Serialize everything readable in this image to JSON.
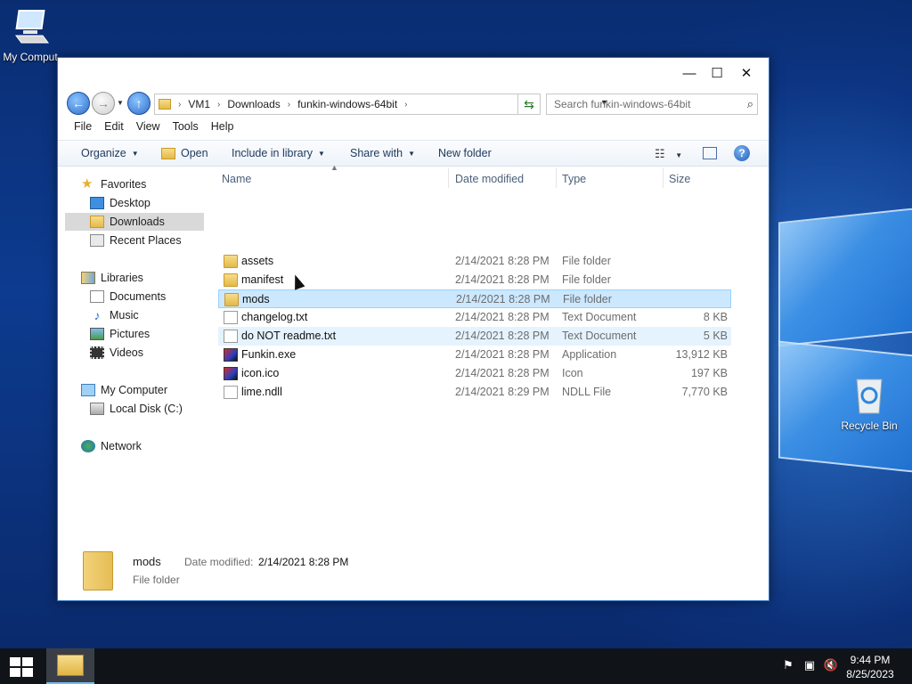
{
  "desktop": {
    "icons": [
      {
        "label": "My Comput"
      },
      {
        "label": "Recycle Bin"
      }
    ]
  },
  "window": {
    "caption": {
      "minimize": "—",
      "maximize": "☐",
      "close": "✕"
    },
    "address": {
      "crumbs": [
        "VM1",
        "Downloads",
        "funkin-windows-64bit"
      ],
      "search_placeholder": "Search funkin-windows-64bit"
    },
    "menu": [
      "File",
      "Edit",
      "View",
      "Tools",
      "Help"
    ],
    "toolbar": {
      "organize": "Organize",
      "open": "Open",
      "include": "Include in library",
      "share": "Share with",
      "new_folder": "New folder"
    },
    "nav": {
      "favorites": "Favorites",
      "desktop": "Desktop",
      "downloads": "Downloads",
      "recent": "Recent Places",
      "libraries": "Libraries",
      "documents": "Documents",
      "music": "Music",
      "pictures": "Pictures",
      "videos": "Videos",
      "computer": "My Computer",
      "localdisk": "Local Disk (C:)",
      "network": "Network"
    },
    "columns": {
      "name": "Name",
      "date": "Date modified",
      "type": "Type",
      "size": "Size"
    },
    "files": [
      {
        "name": "assets",
        "date": "2/14/2021 8:28 PM",
        "type": "File folder",
        "size": "",
        "icon": "folder-icon"
      },
      {
        "name": "manifest",
        "date": "2/14/2021 8:28 PM",
        "type": "File folder",
        "size": "",
        "icon": "folder-icon"
      },
      {
        "name": "mods",
        "date": "2/14/2021 8:28 PM",
        "type": "File folder",
        "size": "",
        "icon": "folder-icon"
      },
      {
        "name": "changelog.txt",
        "date": "2/14/2021 8:28 PM",
        "type": "Text Document",
        "size": "8 KB",
        "icon": "text-file-icon"
      },
      {
        "name": "do NOT readme.txt",
        "date": "2/14/2021 8:28 PM",
        "type": "Text Document",
        "size": "5 KB",
        "icon": "text-file-icon"
      },
      {
        "name": "Funkin.exe",
        "date": "2/14/2021 8:28 PM",
        "type": "Application",
        "size": "13,912 KB",
        "icon": "app-icon"
      },
      {
        "name": "icon.ico",
        "date": "2/14/2021 8:28 PM",
        "type": "Icon",
        "size": "197 KB",
        "icon": "app-icon"
      },
      {
        "name": "lime.ndll",
        "date": "2/14/2021 8:29 PM",
        "type": "NDLL File",
        "size": "7,770 KB",
        "icon": "generic-file-icon"
      }
    ],
    "details": {
      "name": "mods",
      "label": "Date modified:",
      "value": "2/14/2021 8:28 PM",
      "type": "File folder"
    }
  },
  "taskbar": {
    "time": "9:44 PM",
    "date": "8/25/2023"
  },
  "colors": {
    "selection": "#cce8ff",
    "selection_border": "#99d1ff",
    "hover": "#e5f3ff",
    "taskbar": "#101418"
  }
}
